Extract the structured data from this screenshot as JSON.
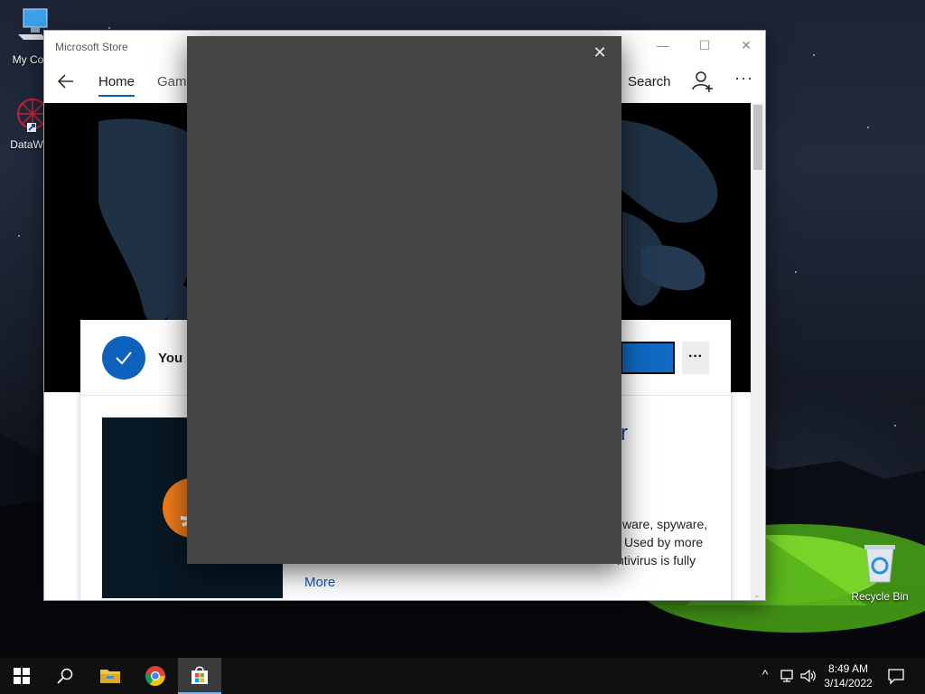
{
  "desktop": {
    "icons": [
      {
        "label": "My Com",
        "icon": "computer-icon"
      },
      {
        "label": "DataWag",
        "icon": "datawag-icon"
      },
      {
        "label": "Recycle Bin",
        "icon": "recycle-bin-icon"
      }
    ]
  },
  "store_window": {
    "title": "Microsoft Store",
    "controls": {
      "minimize": "—",
      "maximize": "☐",
      "close": "✕"
    },
    "nav": {
      "back_icon": "back-arrow-icon",
      "tabs": [
        {
          "label": "Home",
          "active": true
        },
        {
          "label": "Gami",
          "active": false
        }
      ],
      "search_label": "Search",
      "user_icon": "add-user-icon",
      "more_label": "···"
    },
    "card": {
      "owned_text": "You c",
      "ellipsis_label": "···",
      "title_fragment": "r",
      "description_fragments": [
        "ware, spyware,",
        "Used by more",
        "ntivirus is fully"
      ],
      "more_link": "More"
    }
  },
  "dialog": {
    "close_label": "✕"
  },
  "taskbar": {
    "buttons": [
      "start-icon",
      "search-icon",
      "file-explorer-icon",
      "chrome-icon",
      "store-icon"
    ],
    "active_button": "store-icon",
    "tray": {
      "chevron": "^",
      "network": "network-icon",
      "volume": "volume-icon"
    },
    "clock": {
      "time": "8:49 AM",
      "date": "3/14/2022"
    },
    "notification_icon": "notification-icon"
  },
  "colors": {
    "accent": "#0063b1",
    "dialog_bg": "#454545",
    "taskbar_bg": "#101010"
  }
}
